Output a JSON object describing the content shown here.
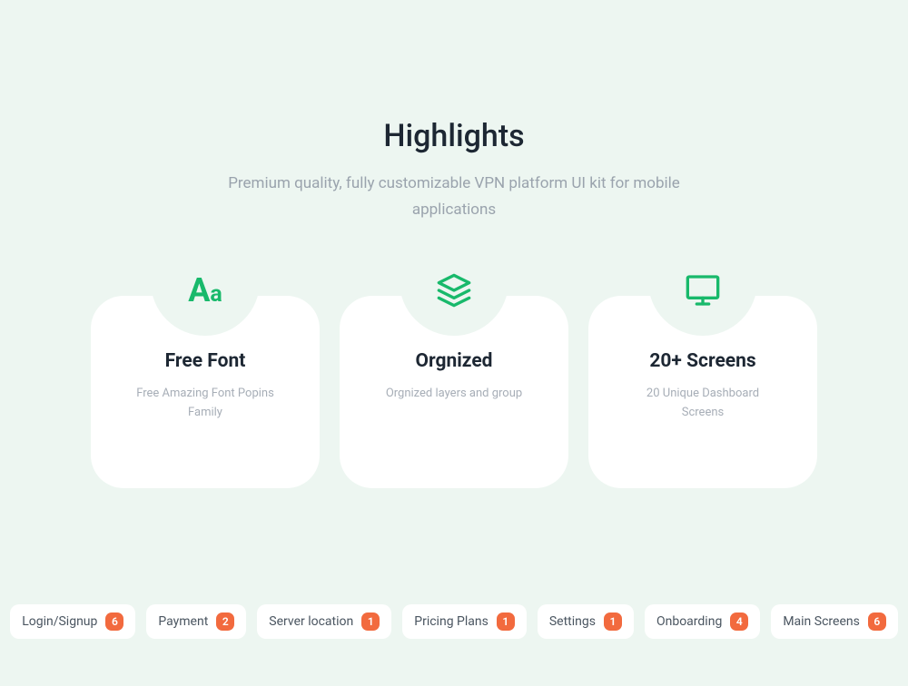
{
  "header": {
    "title": "Highlights",
    "subtitle": "Premium quality, fully customizable VPN platform UI kit for mobile applications"
  },
  "cards": [
    {
      "icon": "font-aa",
      "title": "Free Font",
      "desc": "Free Amazing Font Popins Family"
    },
    {
      "icon": "layers",
      "title": "Orgnized",
      "desc": "Orgnized layers and group"
    },
    {
      "icon": "monitor",
      "title": "20+ Screens",
      "desc": "20 Unique Dashboard Screens"
    }
  ],
  "chips": [
    {
      "label": "Login/Signup",
      "count": "6"
    },
    {
      "label": "Payment",
      "count": "2"
    },
    {
      "label": "Server location",
      "count": "1"
    },
    {
      "label": "Pricing Plans",
      "count": "1"
    },
    {
      "label": "Settings",
      "count": "1"
    },
    {
      "label": "Onboarding",
      "count": "4"
    },
    {
      "label": "Main Screens",
      "count": "6"
    }
  ]
}
